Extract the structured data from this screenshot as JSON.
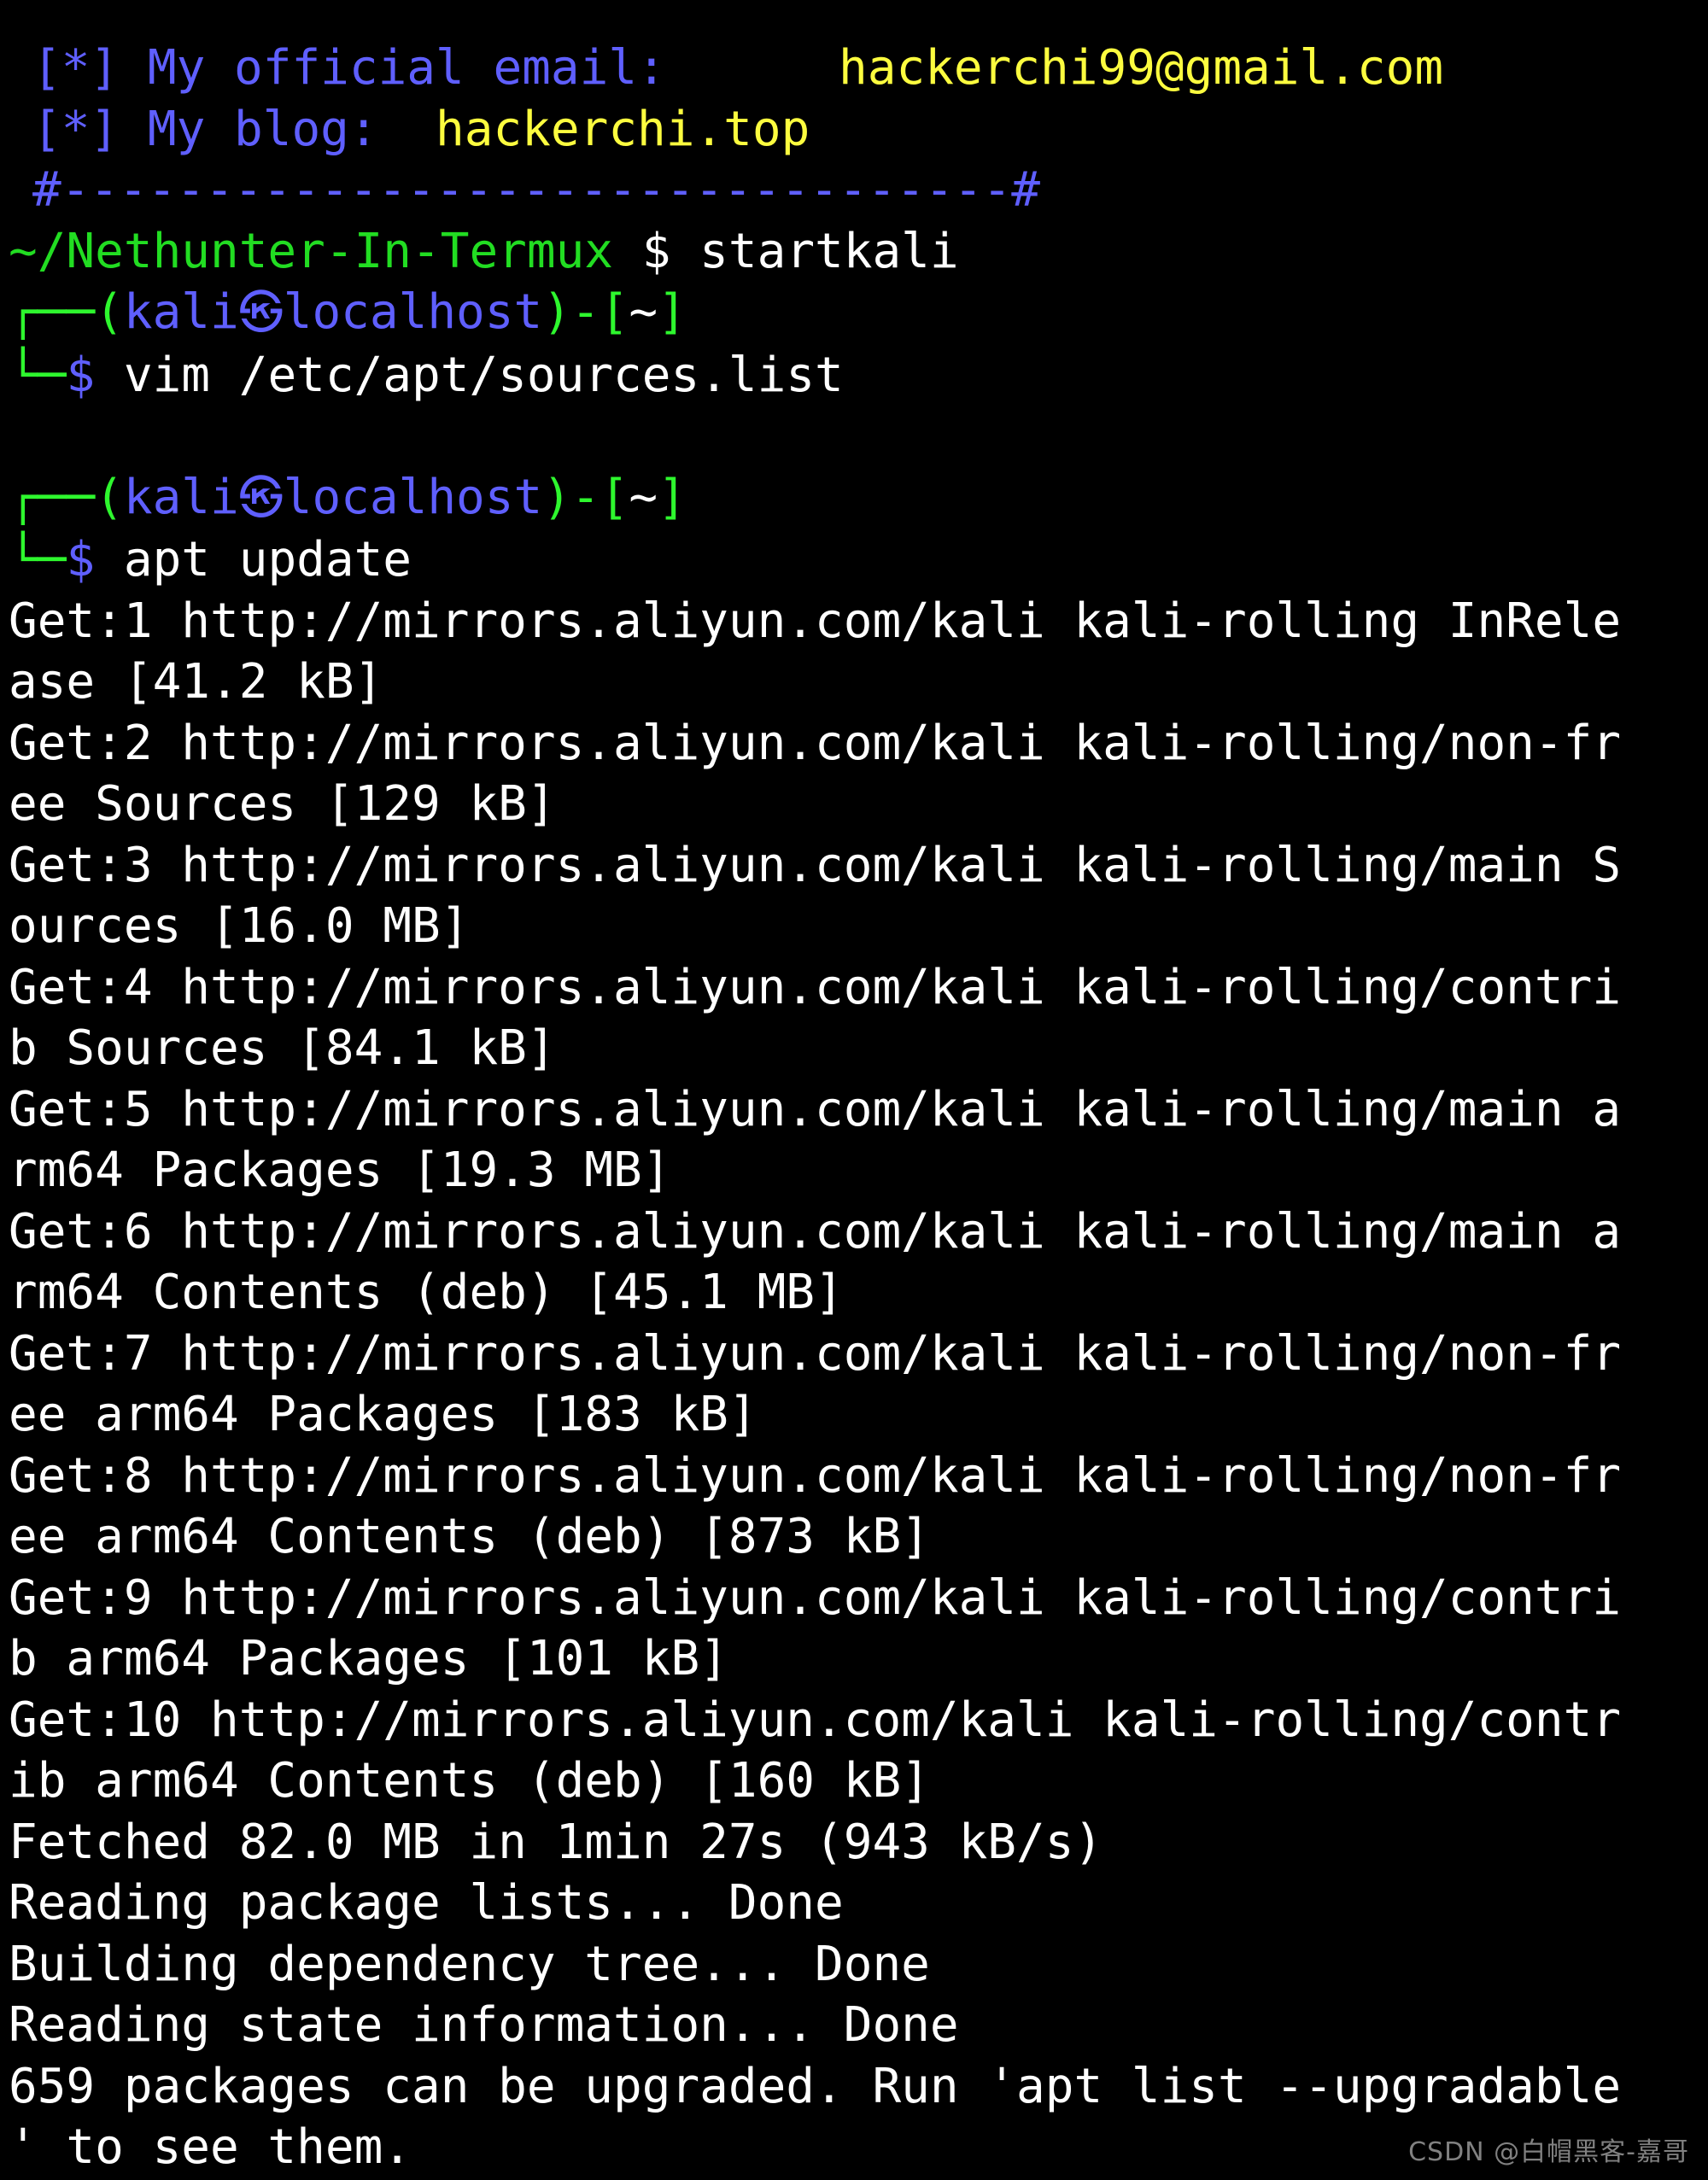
{
  "terminal": {
    "background_color": "#000000",
    "colors": {
      "blue": "#5f5fff",
      "yellow": "#fcfc3f",
      "green": "#2ef72e",
      "white": "#ffffff",
      "watermark_gray": "#8d8d8d"
    },
    "banner": {
      "email_marker": "[*]",
      "email_label": "My official email:",
      "email_value": "hackerchi99@gmail.com",
      "blog_marker": "[*]",
      "blog_label": "My blog:",
      "blog_value": "hackerchi.top",
      "separator": "#---------------------------------#"
    },
    "termux_prompt": {
      "path": "~/Nethunter-In-Termux",
      "symbol": "$",
      "command": "startkali"
    },
    "kali_prompts": [
      {
        "top_box": "┌──",
        "open_paren": "(",
        "user": "kali",
        "at_glyph": "㉿",
        "host": "localhost",
        "close_paren": ")",
        "dash": "-",
        "open_bracket": "[",
        "cwd": "~",
        "close_bracket": "]",
        "bottom_box": "└─",
        "symbol": "$",
        "command": "vim /etc/apt/sources.list"
      },
      {
        "top_box": "┌──",
        "open_paren": "(",
        "user": "kali",
        "at_glyph": "㉿",
        "host": "localhost",
        "close_paren": ")",
        "dash": "-",
        "open_bracket": "[",
        "cwd": "~",
        "close_bracket": "]",
        "bottom_box": "└─",
        "symbol": "$",
        "command": "apt update"
      }
    ],
    "output_lines": [
      "Get:1 http://mirrors.aliyun.com/kali kali-rolling InRele",
      "ase [41.2 kB]",
      "Get:2 http://mirrors.aliyun.com/kali kali-rolling/non-fr",
      "ee Sources [129 kB]",
      "Get:3 http://mirrors.aliyun.com/kali kali-rolling/main S",
      "ources [16.0 MB]",
      "Get:4 http://mirrors.aliyun.com/kali kali-rolling/contri",
      "b Sources [84.1 kB]",
      "Get:5 http://mirrors.aliyun.com/kali kali-rolling/main a",
      "rm64 Packages [19.3 MB]",
      "Get:6 http://mirrors.aliyun.com/kali kali-rolling/main a",
      "rm64 Contents (deb) [45.1 MB]",
      "Get:7 http://mirrors.aliyun.com/kali kali-rolling/non-fr",
      "ee arm64 Packages [183 kB]",
      "Get:8 http://mirrors.aliyun.com/kali kali-rolling/non-fr",
      "ee arm64 Contents (deb) [873 kB]",
      "Get:9 http://mirrors.aliyun.com/kali kali-rolling/contri",
      "b arm64 Packages [101 kB]",
      "Get:10 http://mirrors.aliyun.com/kali kali-rolling/contr",
      "ib arm64 Contents (deb) [160 kB]",
      "Fetched 82.0 MB in 1min 27s (943 kB/s)",
      "Reading package lists... Done",
      "Building dependency tree... Done",
      "Reading state information... Done",
      "659 packages can be upgraded. Run 'apt list --upgradable",
      "' to see them."
    ]
  },
  "watermark": {
    "text": "CSDN @白帽黑客-嘉哥"
  }
}
